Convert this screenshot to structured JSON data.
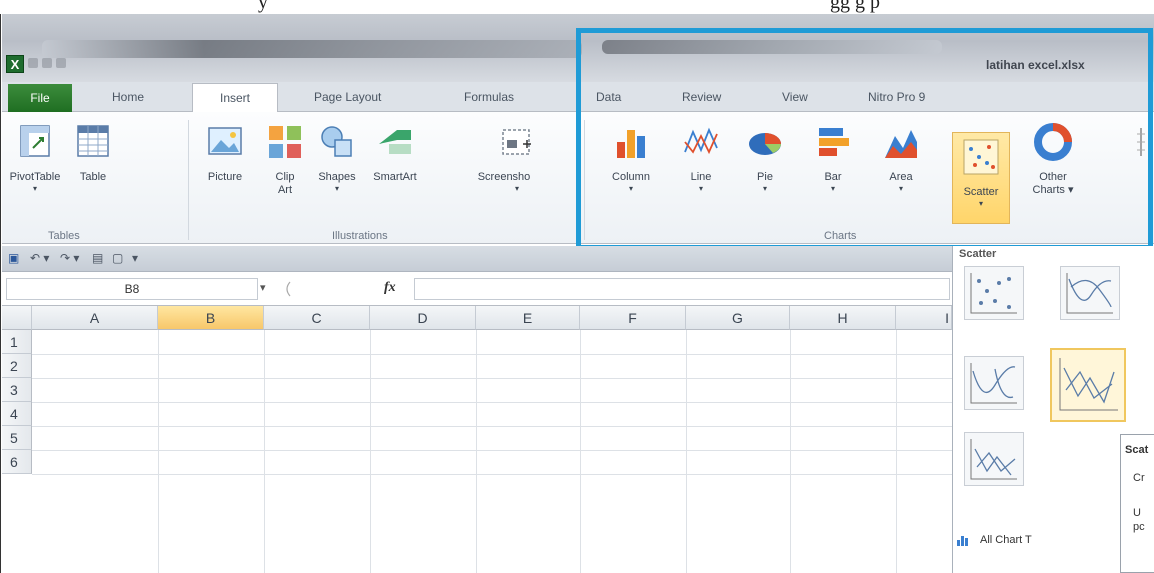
{
  "page": {
    "caption_fragment": "y",
    "caption_fragment_right": "gg    g    p"
  },
  "window": {
    "app_icon": "excel-icon",
    "title": "latihan excel.xlsx"
  },
  "tabs": [
    {
      "label": "File"
    },
    {
      "label": "Home"
    },
    {
      "label": "Insert"
    },
    {
      "label": "Page Layout"
    },
    {
      "label": "Formulas"
    },
    {
      "label": "Data"
    },
    {
      "label": "Review"
    },
    {
      "label": "View"
    },
    {
      "label": "Nitro Pro 9"
    }
  ],
  "ribbon": {
    "tables": {
      "group_label": "Tables",
      "buttons": [
        {
          "label": "PivotTable",
          "icon": "pivot-table-icon"
        },
        {
          "label": "Table",
          "icon": "table-icon"
        }
      ]
    },
    "illustrations": {
      "group_label": "Illustrations",
      "buttons": [
        {
          "label": "Picture",
          "icon": "picture-icon"
        },
        {
          "label": "Clip",
          "label2": "Art",
          "icon": "clip-art-icon"
        },
        {
          "label": "Shapes",
          "icon": "shapes-icon"
        },
        {
          "label": "SmartArt",
          "icon": "smartart-icon"
        },
        {
          "label": "Screensho",
          "icon": "screenshot-icon"
        }
      ]
    },
    "charts": {
      "group_label": "Charts",
      "buttons": [
        {
          "label": "Column",
          "icon": "column-chart-icon"
        },
        {
          "label": "Line",
          "icon": "line-chart-icon"
        },
        {
          "label": "Pie",
          "icon": "pie-chart-icon"
        },
        {
          "label": "Bar",
          "icon": "bar-chart-icon"
        },
        {
          "label": "Area",
          "icon": "area-chart-icon"
        },
        {
          "label": "Scatter",
          "icon": "scatter-chart-icon",
          "active": true
        },
        {
          "label": "Other",
          "label2": "Charts",
          "icon": "other-charts-icon"
        }
      ]
    }
  },
  "formula_bar": {
    "name_box": "B8",
    "fx": "fx"
  },
  "sheet": {
    "columns": [
      "A",
      "B",
      "C",
      "D",
      "E",
      "F",
      "G",
      "H",
      "I"
    ],
    "selected_column": "B",
    "rows": [
      "1",
      "2",
      "3",
      "4",
      "5",
      "6"
    ]
  },
  "scatter_menu": {
    "header": "Scatter",
    "tooltip_lines": [
      "Scat",
      "Cr",
      "U",
      "pc"
    ],
    "all_charts": "All Chart T"
  },
  "colors": {
    "highlight": "#1f9bd6",
    "file_tab": "#2e7d32",
    "active_button": "#ffd56a"
  }
}
